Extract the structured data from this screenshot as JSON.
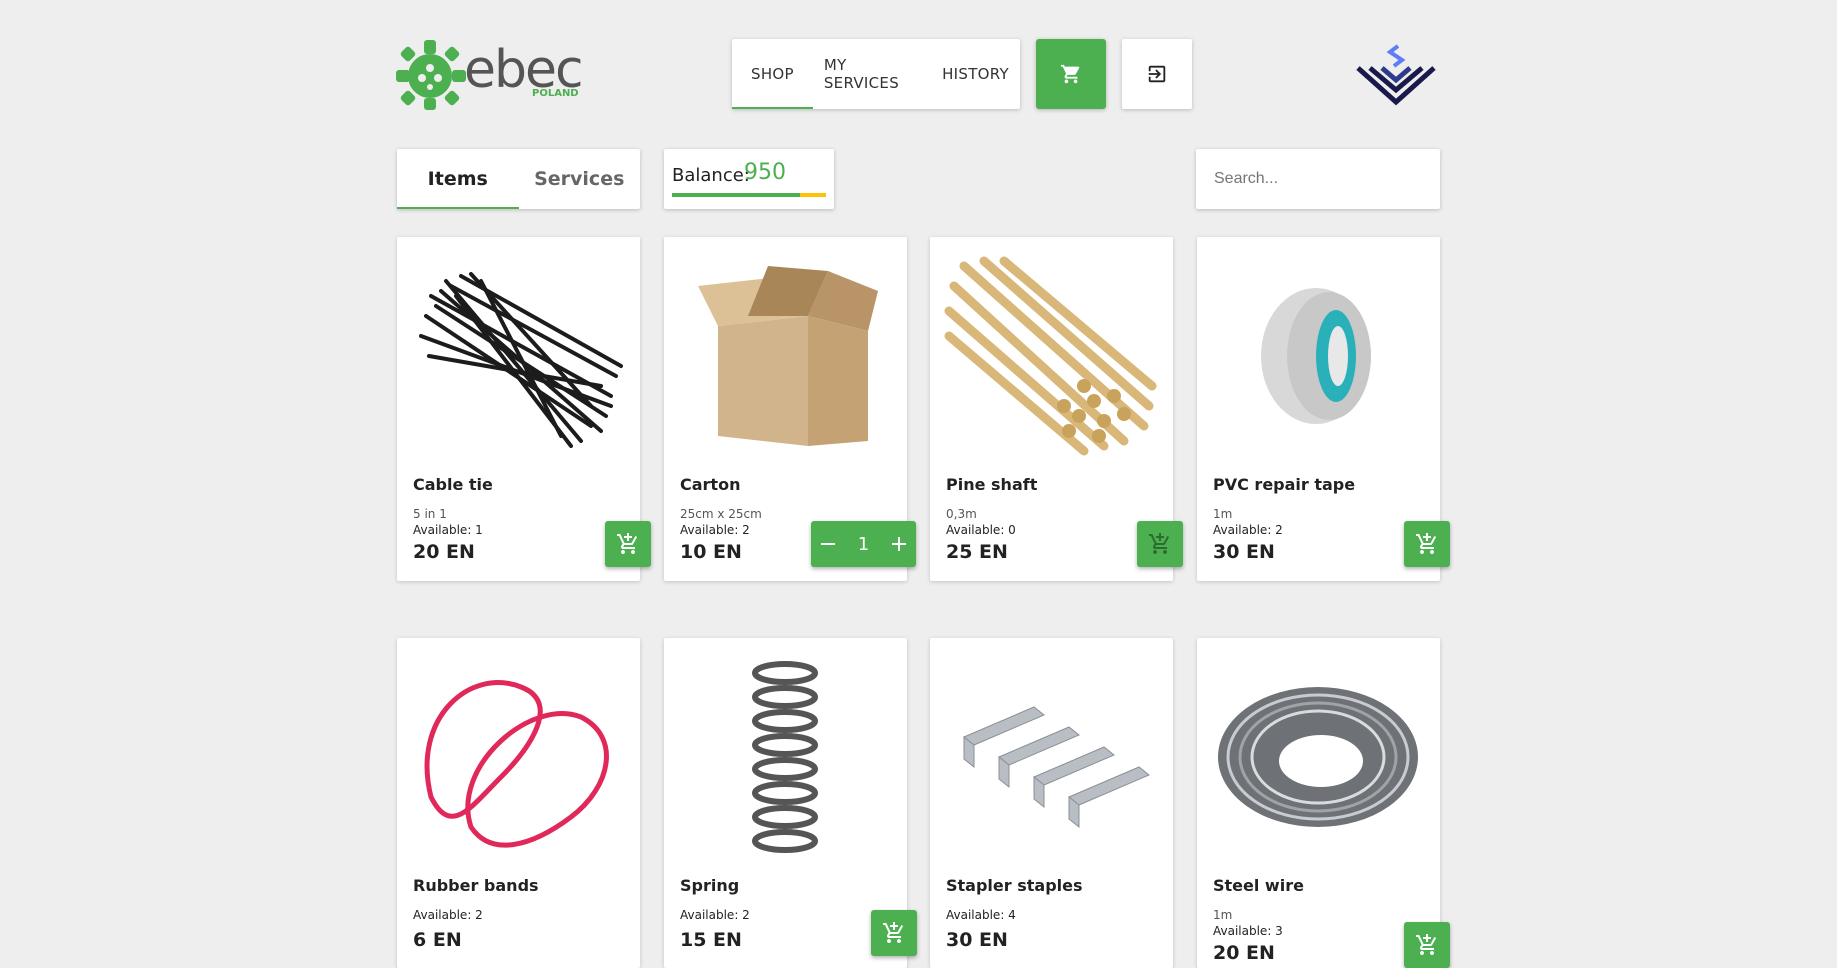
{
  "brand": {
    "logo_text": "ebec",
    "logo_sub": "POLAND"
  },
  "nav": {
    "shop": "SHOP",
    "my_services": "MY SERVICES",
    "history": "HISTORY"
  },
  "tabs": {
    "items": "Items",
    "services": "Services"
  },
  "balance": {
    "label": "Balance:",
    "value": "950",
    "progress_fraction": 0.83
  },
  "search": {
    "placeholder": "Search..."
  },
  "colors": {
    "accent": "#4caf50",
    "warn": "#ffc107",
    "background": "#eeeeee"
  },
  "products": [
    {
      "name": "Cable tie",
      "desc": "5 in 1",
      "available": "Available: 1",
      "price": "20 EN",
      "icon": "cable-tie-image"
    },
    {
      "name": "Carton",
      "desc": "25cm x 25cm",
      "available": "Available: 2",
      "price": "10 EN",
      "icon": "carton-image",
      "quantity": "1"
    },
    {
      "name": "Pine shaft",
      "desc": "0,3m",
      "available": "Available: 0",
      "price": "25 EN",
      "icon": "pine-shaft-image"
    },
    {
      "name": "PVC repair tape",
      "desc": "1m",
      "available": "Available: 2",
      "price": "30 EN",
      "icon": "tape-image"
    },
    {
      "name": "Rubber bands",
      "desc": "",
      "available": "Available: 2",
      "price": "6 EN",
      "icon": "rubber-bands-image"
    },
    {
      "name": "Spring",
      "desc": "",
      "available": "Available: 2",
      "price": "15 EN",
      "icon": "spring-image"
    },
    {
      "name": "Stapler staples",
      "desc": "",
      "available": "Available: 4",
      "price": "30 EN",
      "icon": "staples-image"
    },
    {
      "name": "Steel wire",
      "desc": "1m",
      "available": "Available: 3",
      "price": "20 EN",
      "icon": "steel-wire-image"
    }
  ]
}
